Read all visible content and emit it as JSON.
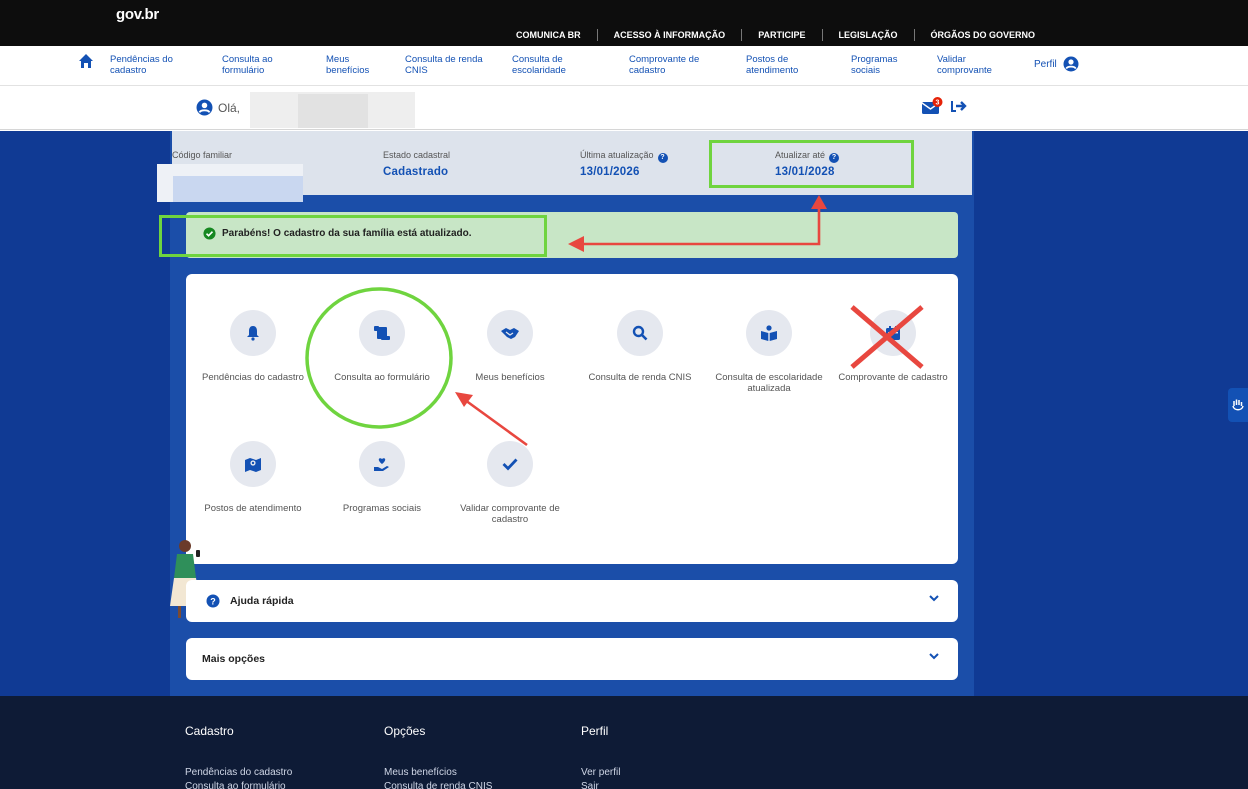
{
  "header": {
    "logo": "gov.br",
    "links": [
      "COMUNICA BR",
      "ACESSO À INFORMAÇÃO",
      "PARTICIPE",
      "LEGISLAÇÃO",
      "ÓRGÃOS DO GOVERNO"
    ]
  },
  "nav": {
    "items": [
      {
        "l1": "Pendências do",
        "l2": "cadastro"
      },
      {
        "l1": "Consulta ao",
        "l2": "formulário"
      },
      {
        "l1": "Meus",
        "l2": "benefícios"
      },
      {
        "l1": "Consulta de renda",
        "l2": "CNIS"
      },
      {
        "l1": "Consulta de",
        "l2": "escolaridade"
      },
      {
        "l1": "Comprovante de",
        "l2": "cadastro"
      },
      {
        "l1": "Postos de",
        "l2": "atendimento"
      },
      {
        "l1": "Programas",
        "l2": "sociais"
      },
      {
        "l1": "Validar",
        "l2": "comprovante"
      }
    ],
    "perfil": "Perfil"
  },
  "greeting": {
    "text": "Olá,",
    "mail_badge": "3"
  },
  "info": {
    "codigo_label": "Código familiar",
    "estado_label": "Estado cadastral",
    "estado_value": "Cadastrado",
    "ultima_label": "Última atualização",
    "ultima_value": "13/01/2026",
    "atualizar_label": "Atualizar até",
    "atualizar_value": "13/01/2028"
  },
  "success": {
    "message": "Parabéns! O cadastro da sua família está atualizado."
  },
  "tiles": [
    {
      "label": "Pendências do cadastro",
      "icon": "bell-icon"
    },
    {
      "label": "Consulta ao formulário",
      "icon": "scroll-icon"
    },
    {
      "label": "Meus benefícios",
      "icon": "handshake-icon"
    },
    {
      "label": "Consulta de renda CNIS",
      "icon": "search-icon"
    },
    {
      "label": "Consulta de escolaridade atualizada",
      "icon": "book-reader-icon"
    },
    {
      "label": "Comprovante de cadastro",
      "icon": "calendar-icon"
    },
    {
      "label": "Postos de atendimento",
      "icon": "map-pin-icon"
    },
    {
      "label": "Programas sociais",
      "icon": "hand-heart-icon"
    },
    {
      "label": "Validar comprovante de cadastro",
      "icon": "check-icon"
    }
  ],
  "accordions": {
    "ajuda": "Ajuda rápida",
    "mais": "Mais opções"
  },
  "footer": {
    "col1": {
      "title": "Cadastro",
      "links": [
        "Pendências do cadastro",
        "Consulta ao formulário"
      ]
    },
    "col2": {
      "title": "Opções",
      "links": [
        "Meus benefícios",
        "Consulta de renda CNIS"
      ]
    },
    "col3": {
      "title": "Perfil",
      "links": [
        "Ver perfil",
        "Sair"
      ]
    }
  },
  "colors": {
    "primary": "#1351b4",
    "annotation_green": "#6fd43f",
    "annotation_red": "#e8473f",
    "success_bg": "#c8e6c6"
  }
}
